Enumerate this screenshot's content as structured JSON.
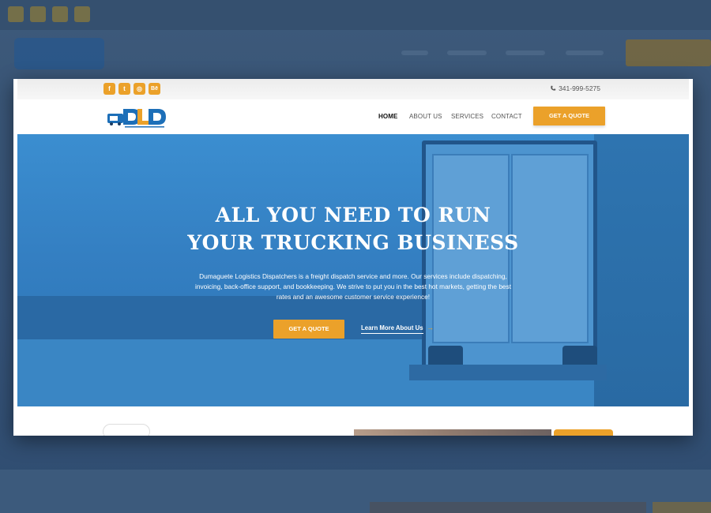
{
  "topbar": {
    "social": [
      {
        "icon": "facebook-icon",
        "glyph": "f"
      },
      {
        "icon": "twitter-icon",
        "glyph": "t"
      },
      {
        "icon": "instagram-icon",
        "glyph": "◎"
      },
      {
        "icon": "behance-icon",
        "glyph": "Bē"
      }
    ],
    "phone": "341-999-5275"
  },
  "header": {
    "logo_text": "DLD",
    "nav": [
      "HOME",
      "ABOUT US",
      "SERVICES",
      "CONTACT"
    ],
    "quote_label": "GET A QUOTE"
  },
  "hero": {
    "title_line1": "ALL YOU NEED TO RUN",
    "title_line2": "YOUR TRUCKING BUSINESS",
    "description": "Dumaguete Logistics Dispatchers is a freight dispatch service and more. Our services include dispatching, invoicing, back-office support, and bookkeeping. We strive to put you in the best hot markets, getting the best rates and an awesome customer service experience!",
    "primary_button": "GET A QUOTE",
    "secondary_link": "Learn More About Us",
    "arrow": "→"
  },
  "colors": {
    "accent": "#eba12a",
    "hero_blue": "#2f7ec3",
    "brand_blue": "#1d6fb8"
  }
}
